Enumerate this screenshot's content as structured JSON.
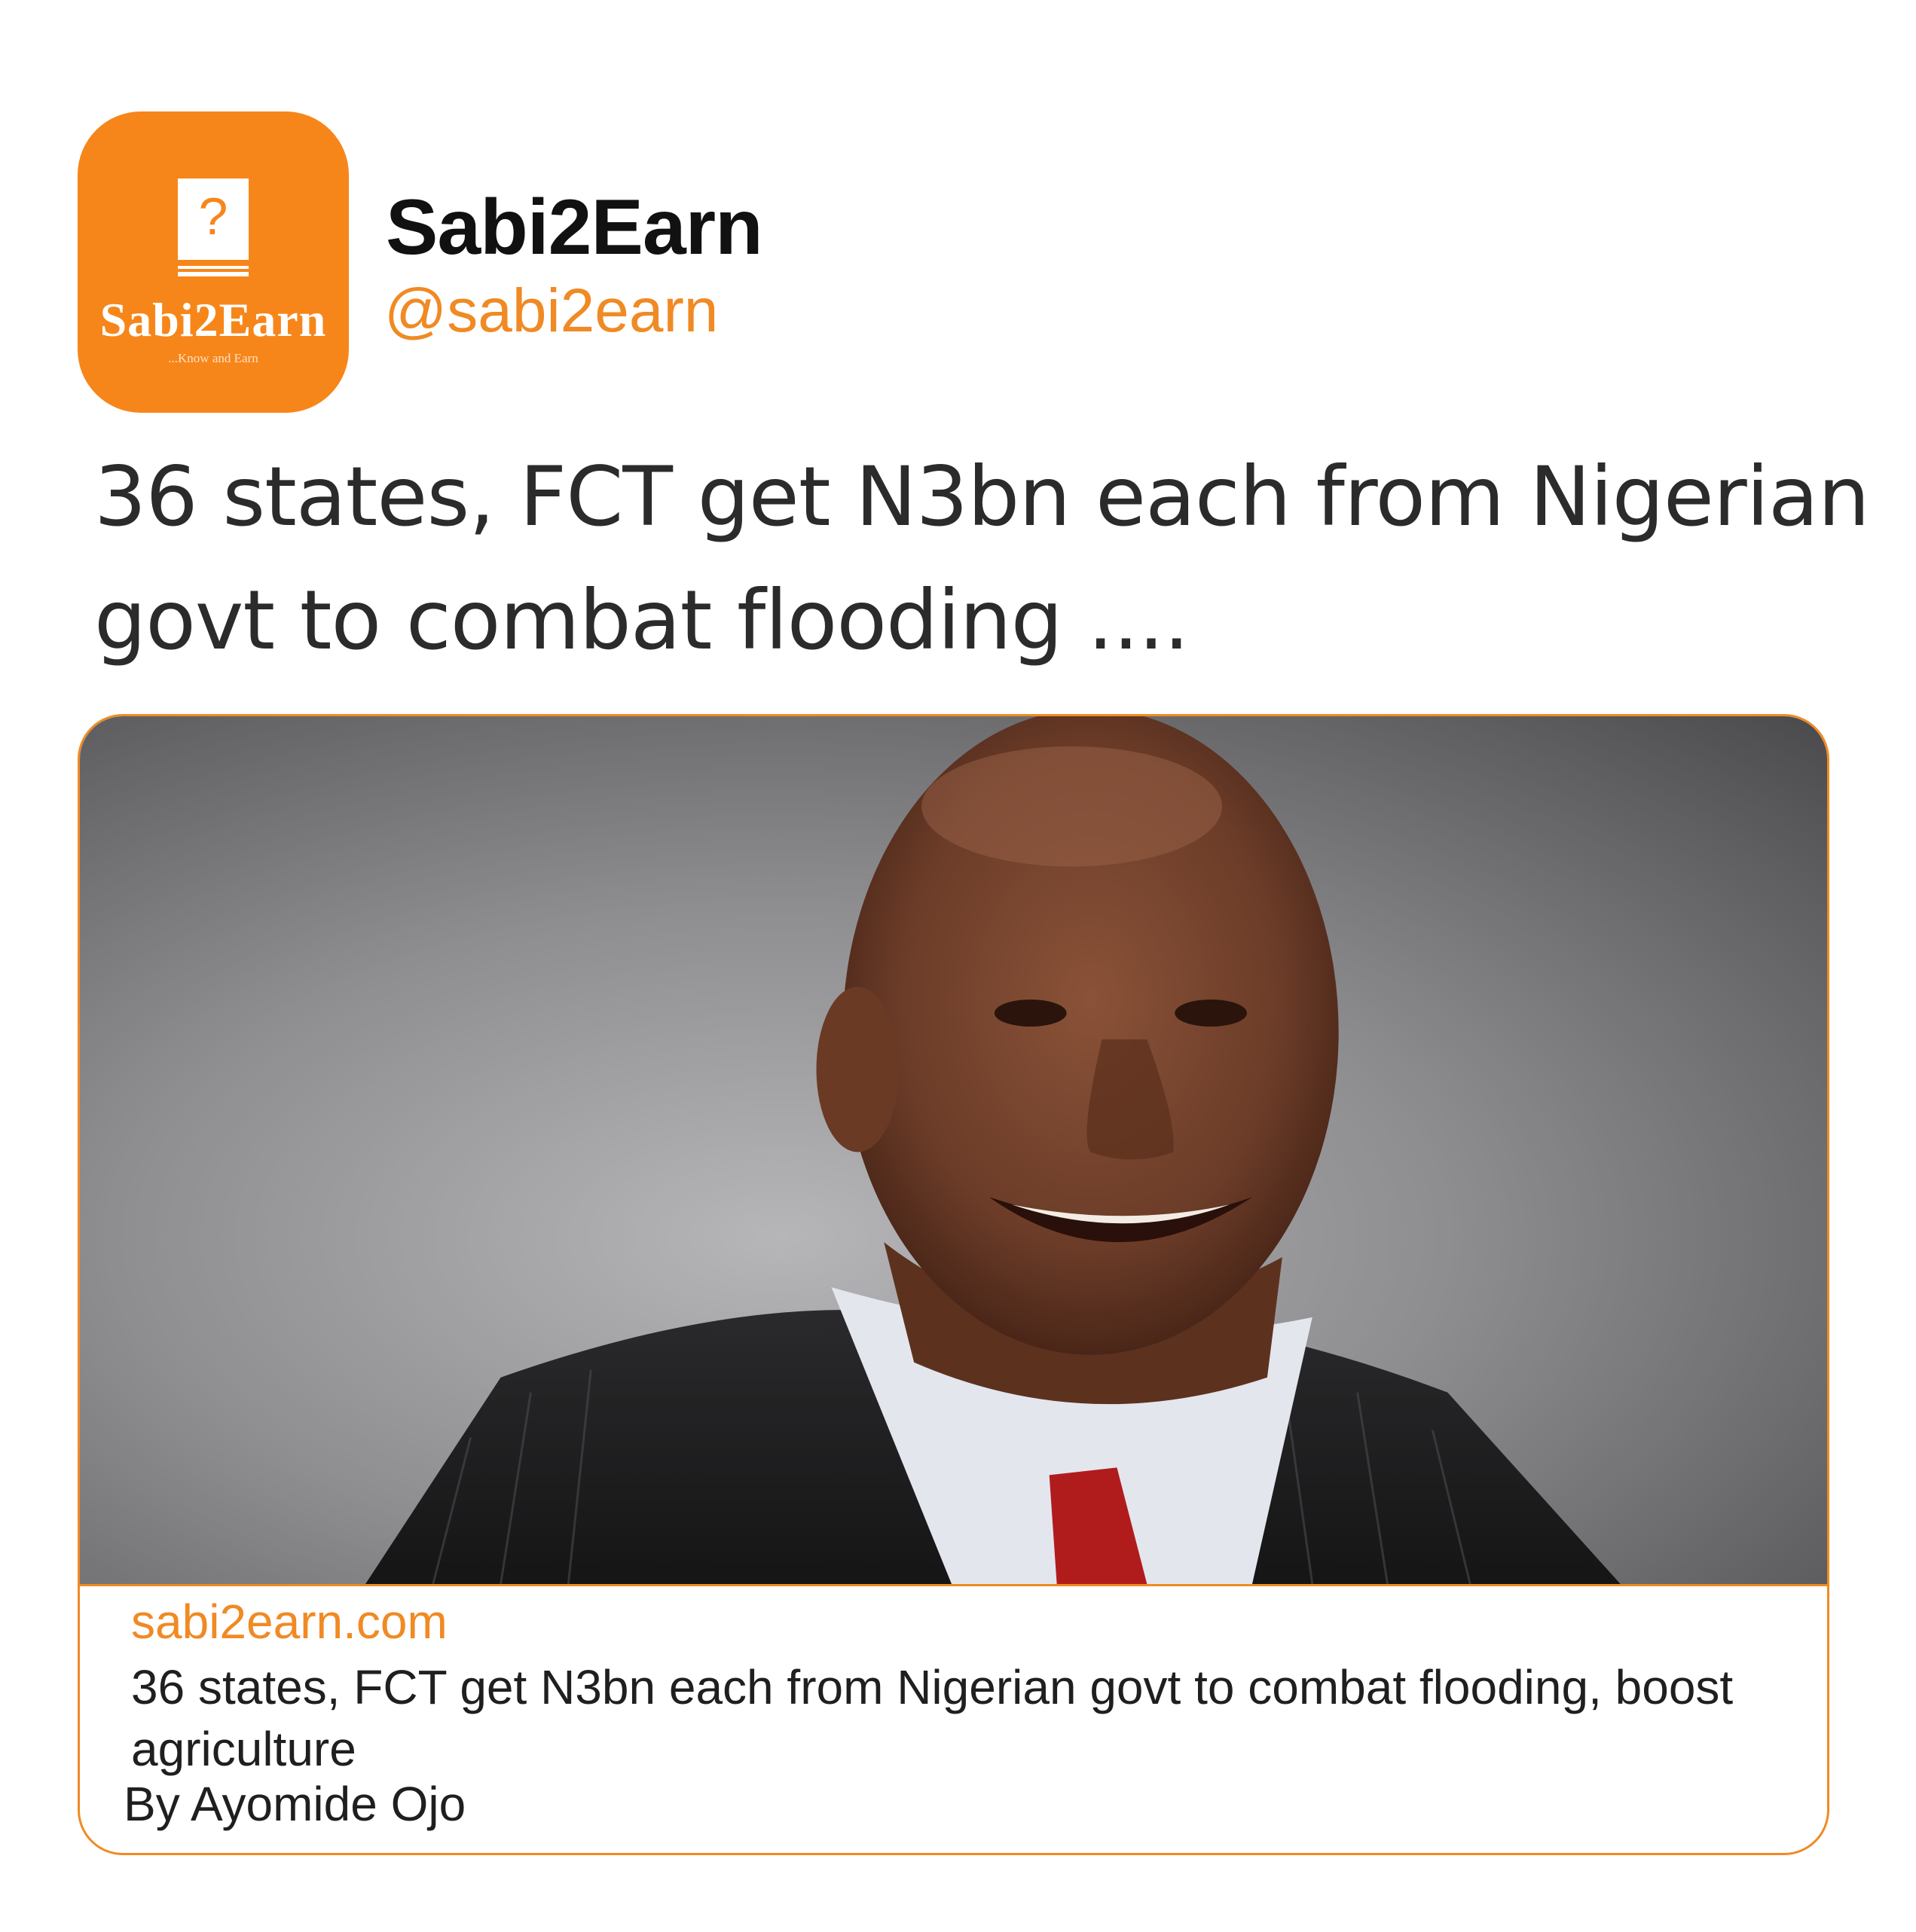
{
  "account": {
    "display_name": "Sabi2Earn",
    "handle": "@sabi2earn",
    "avatar": {
      "logo_word": "Sabi2Earn",
      "logo_tagline": "...Know and Earn",
      "icon": "question-book-icon",
      "background_color": "#f7861a"
    }
  },
  "tweet": {
    "text": "36 states, FCT get N3bn each from Nigerian govt to combat flooding ...."
  },
  "link_card": {
    "image": "portrait-photo",
    "domain": "sabi2earn.com",
    "title": "36 states, FCT get N3bn each from Nigerian govt to combat flooding, boost agriculture",
    "byline": "By Ayomide Ojo",
    "border_color": "#f08a24"
  }
}
